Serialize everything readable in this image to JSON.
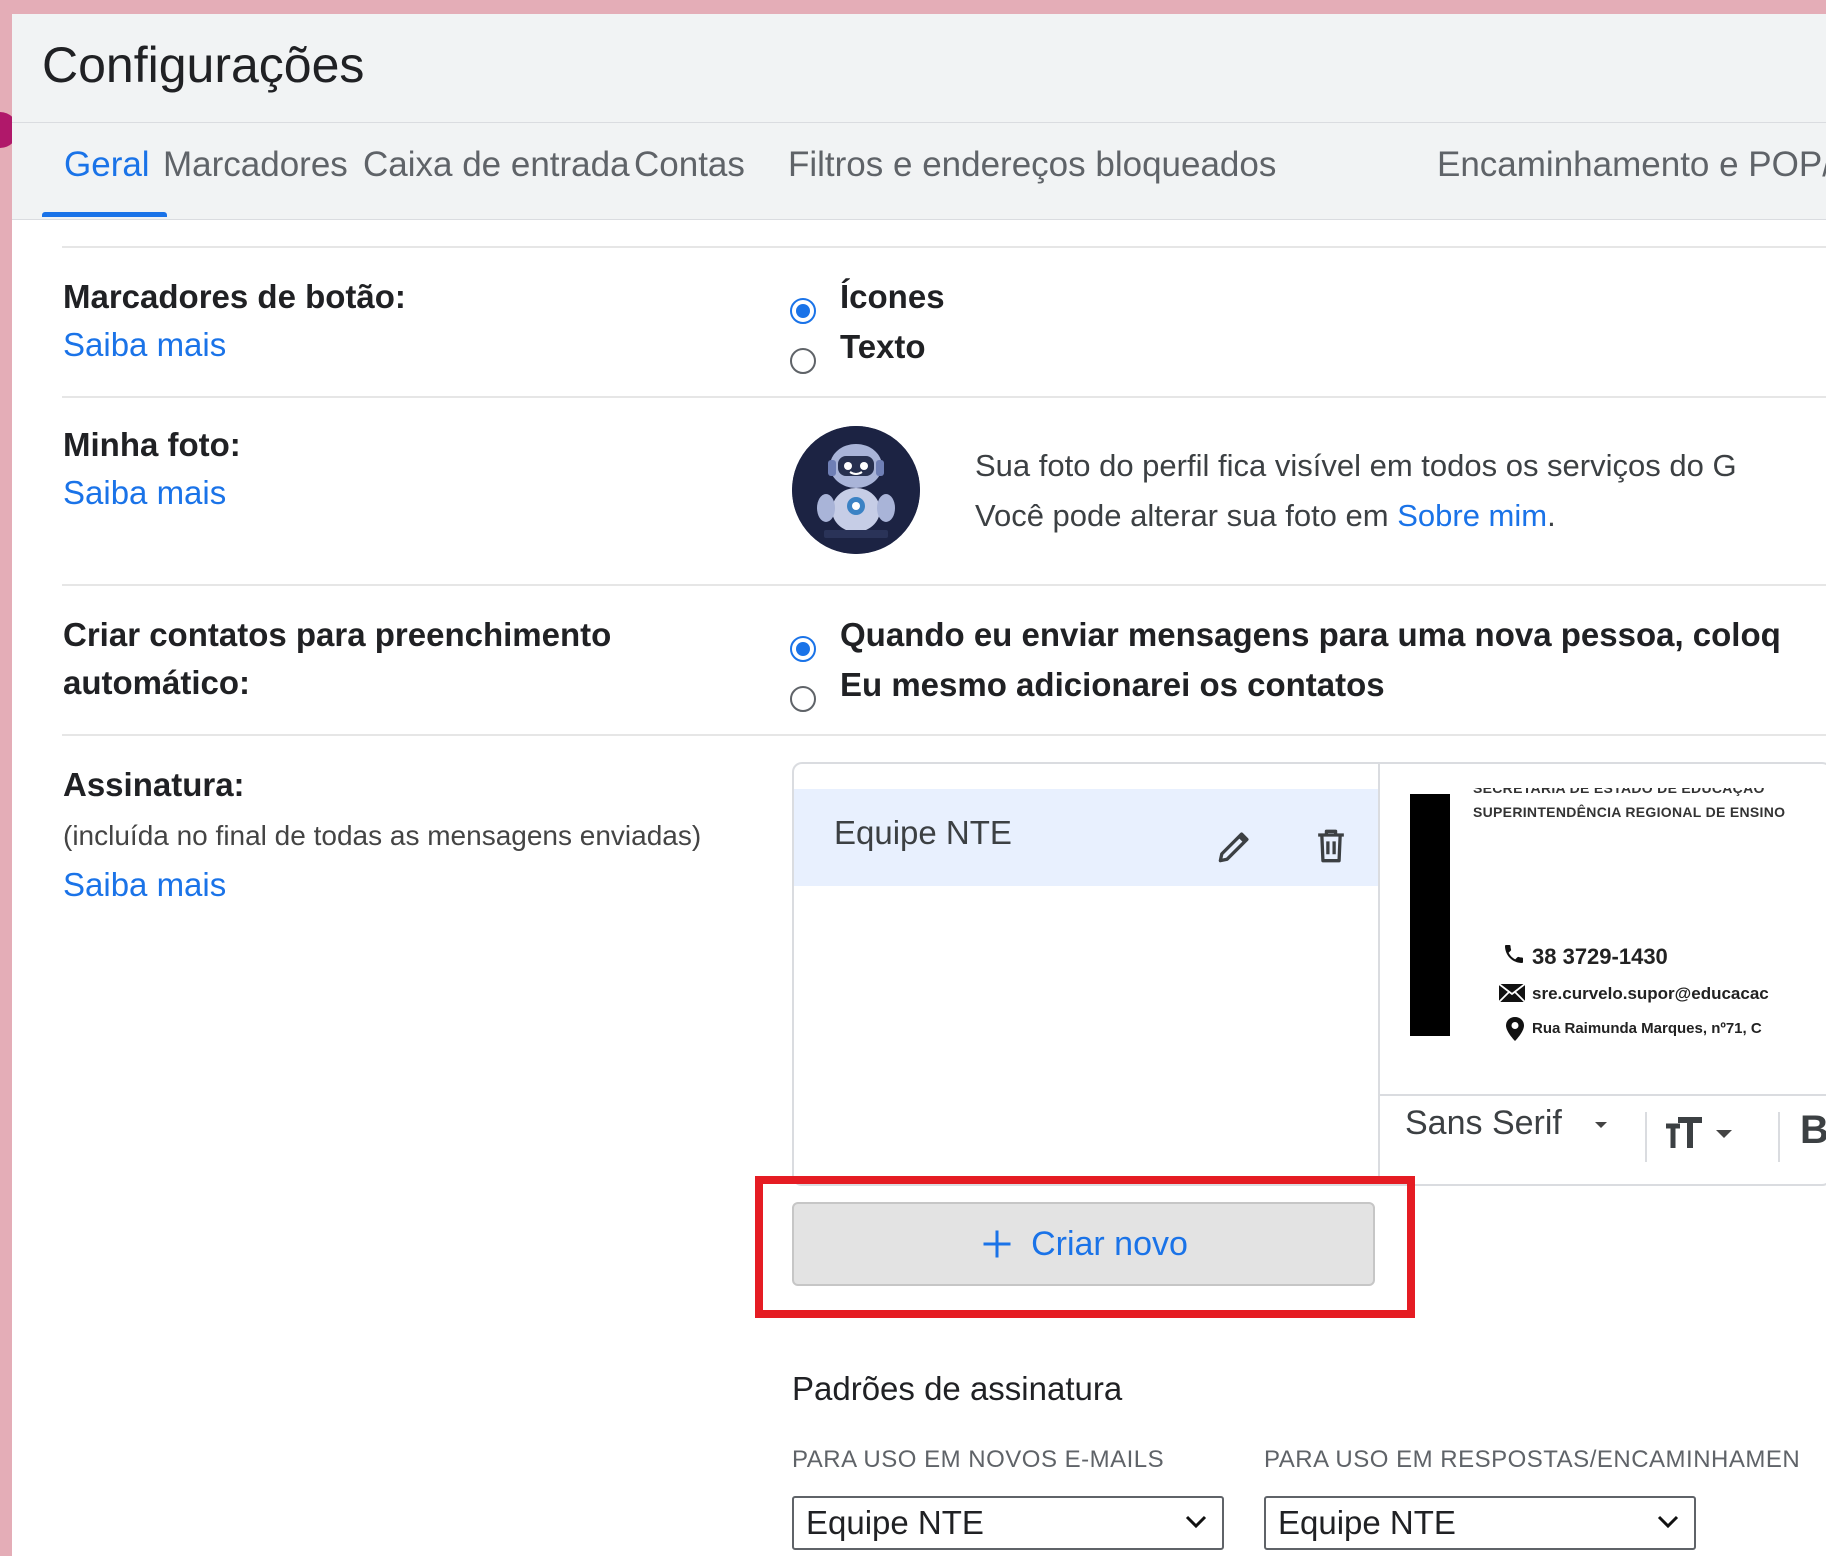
{
  "window": {
    "title": "Configurações"
  },
  "tabs": [
    "Geral",
    "Marcadores",
    "Caixa de entrada",
    "Contas",
    "Filtros e endereços bloqueados",
    "Encaminhamento e POP/"
  ],
  "button_labels": {
    "label": "Marcadores de botão:",
    "learn_more": "Saiba mais",
    "options": [
      "Ícones",
      "Texto"
    ],
    "selected": "Ícones"
  },
  "my_photo": {
    "label": "Minha foto:",
    "learn_more": "Saiba mais",
    "line1": "Sua foto do perfil fica visível em todos os serviços do G",
    "line2_prefix": "Você pode alterar sua foto em ",
    "line2_link": "Sobre mim",
    "line2_suffix": "."
  },
  "autocomplete": {
    "label_line1": "Criar contatos para preenchimento",
    "label_line2": "automático:",
    "options": [
      "Quando eu enviar mensagens para uma nova pessoa, coloq",
      "Eu mesmo adicionarei os contatos"
    ],
    "selected": 0
  },
  "signature": {
    "label": "Assinatura:",
    "sublabel": "(incluída no final de todas as mensagens enviadas)",
    "learn_more": "Saiba mais",
    "items": [
      {
        "name": "Equipe NTE"
      }
    ],
    "preview": {
      "header1": "SECRETARIA DE ESTADO DE EDUCAÇÃO",
      "header2": "SUPERINTENDÊNCIA REGIONAL DE ENSINO",
      "phone": "38 3729-1430",
      "email": "sre.curvelo.supor@educacac",
      "address": "Rua Raimunda Marques, nº71, C"
    },
    "toolbar": {
      "font": "Sans Serif",
      "bold": "B"
    },
    "create_button": "Criar novo"
  },
  "defaults": {
    "title": "Padrões de assinatura",
    "new_emails_label": "PARA USO EM NOVOS E-MAILS",
    "replies_label": "PARA USO EM RESPOSTAS/ENCAMINHAMEN",
    "new_emails_value": "Equipe NTE",
    "replies_value": "Equipe NTE"
  },
  "colors": {
    "accent": "#1a73e8",
    "highlight": "#e51c23",
    "background": "#e4adb7"
  }
}
